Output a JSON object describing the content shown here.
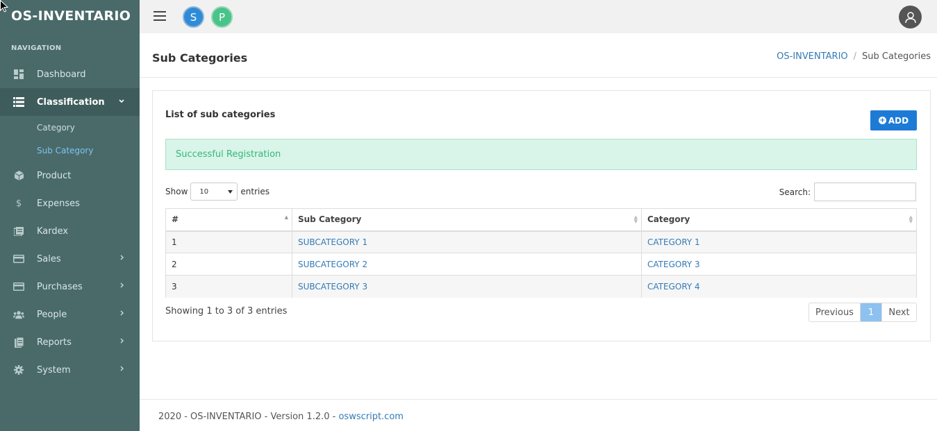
{
  "brand": "OS-INVENTARIO",
  "nav_header": "NAVIGATION",
  "nav": [
    {
      "label": "Dashboard",
      "icon": "dashboard-icon"
    },
    {
      "label": "Classification",
      "icon": "list-icon",
      "active": true
    },
    {
      "label": "Product",
      "icon": "cube-icon"
    },
    {
      "label": "Expenses",
      "icon": "dollar-icon"
    },
    {
      "label": "Kardex",
      "icon": "book-icon"
    },
    {
      "label": "Sales",
      "icon": "card-icon"
    },
    {
      "label": "Purchases",
      "icon": "card-icon"
    },
    {
      "label": "People",
      "icon": "users-icon"
    },
    {
      "label": "Reports",
      "icon": "file-icon"
    },
    {
      "label": "System",
      "icon": "gear-icon"
    }
  ],
  "sub_nav": [
    {
      "label": "Category"
    },
    {
      "label": "Sub Category",
      "current": true
    }
  ],
  "header": {
    "avatar_s": "S",
    "avatar_p": "P"
  },
  "page": {
    "title": "Sub Categories",
    "breadcrumb_home": "OS-INVENTARIO",
    "breadcrumb_current": "Sub Categories"
  },
  "card": {
    "title": "List of sub categories",
    "add_label": "ADD",
    "alert": "Successful Registration",
    "show_label": "Show",
    "show_value": "10",
    "entries_label": "entries",
    "search_label": "Search:",
    "columns": [
      "#",
      "Sub Category",
      "Category"
    ],
    "rows": [
      {
        "num": "1",
        "sub": "SUBCATEGORY 1",
        "cat": "CATEGORY 1"
      },
      {
        "num": "2",
        "sub": "SUBCATEGORY 2",
        "cat": "CATEGORY 3"
      },
      {
        "num": "3",
        "sub": "SUBCATEGORY 3",
        "cat": "CATEGORY 4"
      }
    ],
    "info": "Showing 1 to 3 of 3 entries",
    "prev": "Previous",
    "page": "1",
    "next": "Next"
  },
  "footer": {
    "text": "2020 - OS-INVENTARIO - Version 1.2.0 - ",
    "link": "oswscript.com"
  },
  "colors": {
    "sidebar": "#4a6a6a",
    "primary": "#1d7bd6",
    "success_bg": "#d9f4e8",
    "success_text": "#34b87a"
  }
}
